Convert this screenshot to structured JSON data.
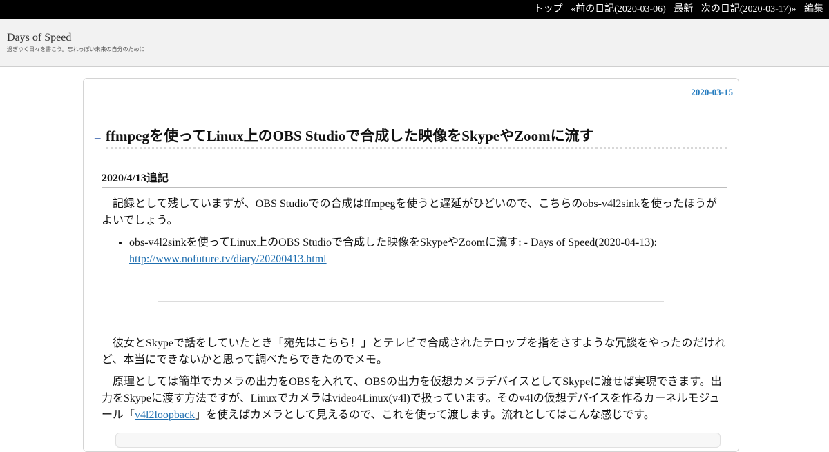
{
  "topbar": {
    "nav": [
      {
        "label": "トップ"
      },
      {
        "label": "«前の日記(2020-03-06)"
      },
      {
        "label": "最新"
      },
      {
        "label": "次の日記(2020-03-17)»"
      },
      {
        "label": "編集"
      }
    ]
  },
  "header": {
    "title": "Days of Speed",
    "description": "過ぎゆく日々を書こう。忘れっぽい未来の自分のために"
  },
  "day": {
    "date": "2020-03-15",
    "section_anchor": "_",
    "section_title": "ffmpegを使ってLinux上のOBS Studioで合成した映像をSkypeやZoomに流す",
    "subsection_title": "2020/4/13追記",
    "note_paragraph": "記録として残していますが、OBS Studioでの合成はffmpegを使うと遅延がひどいので、こちらのobs-v4l2sinkを使ったほうがよいでしょう。",
    "note_link_text": "obs-v4l2sinkを使ってLinux上のOBS Studioで合成した映像をSkypeやZoomに流す: - Days of Speed(2020-04-13):",
    "note_link_url": "http://www.nofuture.tv/diary/20200413.html",
    "paragraph1": "彼女とSkypeで話をしていたとき「宛先はこちら！」とテレビで合成されたテロップを指をさすような冗談をやったのだけれど、本当にできないかと思って調べたらできたのでメモ。",
    "paragraph2_before": "原理としては簡単でカメラの出力をOBSを入れて、OBSの出力を仮想カメラデバイスとしてSkypeに渡せば実現できます。出力をSkypeに渡す方法ですが、Linuxでカメラはvideo4Linux(v4l)で扱っています。そのv4lの仮想デバイスを作るカーネルモジュール「",
    "paragraph2_link": "v4l2loopback",
    "paragraph2_after": "」を使えばカメラとして見えるので、これを使って渡します。流れとしてはこんな感じです。"
  }
}
